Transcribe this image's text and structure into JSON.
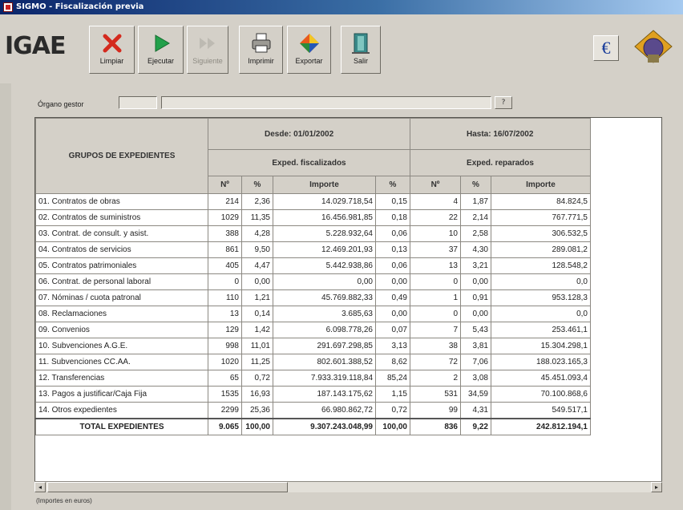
{
  "window": {
    "title": "SIGMO - Fiscalización previa"
  },
  "toolbar": {
    "logo": "IGAE",
    "buttons": [
      {
        "label": "Limpiar",
        "icon": "clear-x-icon",
        "enabled": true
      },
      {
        "label": "Ejecutar",
        "icon": "play-icon",
        "enabled": true
      },
      {
        "label": "Siguiente",
        "icon": "fast-forward-icon",
        "enabled": false
      },
      {
        "label": "Imprimir",
        "icon": "printer-icon",
        "enabled": true
      },
      {
        "label": "Exportar",
        "icon": "export-icon",
        "enabled": true
      },
      {
        "label": "Salir",
        "icon": "exit-door-icon",
        "enabled": true
      }
    ],
    "euro_symbol": "€"
  },
  "organo": {
    "label": "Órgano gestor",
    "code": "",
    "name": "",
    "lookup": "?"
  },
  "table": {
    "header": {
      "group_title": "GRUPOS DE EXPEDIENTES",
      "period_from": "Desde: 01/01/2002",
      "period_to": "Hasta: 16/07/2002",
      "section_fiscalizados": "Exped. fiscalizados",
      "section_reparados": "Exped. reparados",
      "col_n": "Nº",
      "col_pct": "%",
      "col_importe": "Importe"
    },
    "rows": [
      [
        "01. Contratos de obras",
        "214",
        "2,36",
        "14.029.718,54",
        "0,15",
        "4",
        "1,87",
        "84.824,5"
      ],
      [
        "02. Contratos de suministros",
        "1029",
        "11,35",
        "16.456.981,85",
        "0,18",
        "22",
        "2,14",
        "767.771,5"
      ],
      [
        "03. Contrat. de consult. y asist.",
        "388",
        "4,28",
        "5.228.932,64",
        "0,06",
        "10",
        "2,58",
        "306.532,5"
      ],
      [
        "04. Contratos de servicios",
        "861",
        "9,50",
        "12.469.201,93",
        "0,13",
        "37",
        "4,30",
        "289.081,2"
      ],
      [
        "05. Contratos patrimoniales",
        "405",
        "4,47",
        "5.442.938,86",
        "0,06",
        "13",
        "3,21",
        "128.548,2"
      ],
      [
        "06. Contrat. de personal laboral",
        "0",
        "0,00",
        "0,00",
        "0,00",
        "0",
        "0,00",
        "0,0"
      ],
      [
        "07. Nóminas / cuota patronal",
        "110",
        "1,21",
        "45.769.882,33",
        "0,49",
        "1",
        "0,91",
        "953.128,3"
      ],
      [
        "08. Reclamaciones",
        "13",
        "0,14",
        "3.685,63",
        "0,00",
        "0",
        "0,00",
        "0,0"
      ],
      [
        "09. Convenios",
        "129",
        "1,42",
        "6.098.778,26",
        "0,07",
        "7",
        "5,43",
        "253.461,1"
      ],
      [
        "10. Subvenciones A.G.E.",
        "998",
        "11,01",
        "291.697.298,85",
        "3,13",
        "38",
        "3,81",
        "15.304.298,1"
      ],
      [
        "11. Subvenciones CC.AA.",
        "1020",
        "11,25",
        "802.601.388,52",
        "8,62",
        "72",
        "7,06",
        "188.023.165,3"
      ],
      [
        "12. Transferencias",
        "65",
        "0,72",
        "7.933.319.118,84",
        "85,24",
        "2",
        "3,08",
        "45.451.093,4"
      ],
      [
        "13. Pagos a justificar/Caja Fija",
        "1535",
        "16,93",
        "187.143.175,62",
        "1,15",
        "531",
        "34,59",
        "70.100.868,6"
      ],
      [
        "14. Otros expedientes",
        "2299",
        "25,36",
        "66.980.862,72",
        "0,72",
        "99",
        "4,31",
        "549.517,1"
      ]
    ],
    "total": [
      "TOTAL EXPEDIENTES",
      "9.065",
      "100,00",
      "9.307.243.048,99",
      "100,00",
      "836",
      "9,22",
      "242.812.194,1"
    ]
  },
  "footnote": "(Importes en euros)"
}
